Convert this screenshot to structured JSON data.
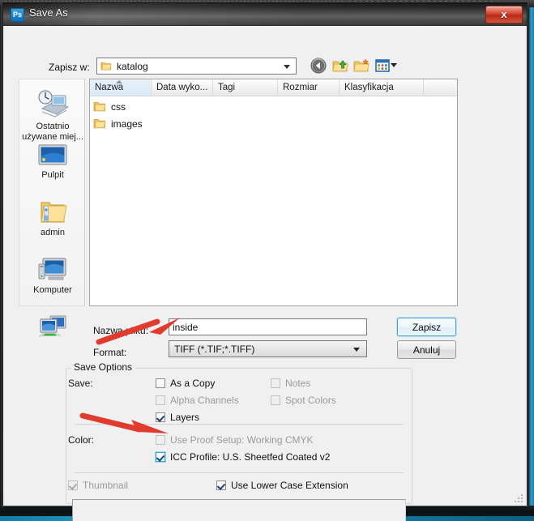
{
  "window": {
    "app_icon": "photoshop-icon",
    "app_icon_text": "Ps",
    "title": "Save As",
    "close_label": "x"
  },
  "toolbar": {
    "look_in_label": "Zapisz w:",
    "look_in_value": "katalog",
    "icons": [
      {
        "name": "back-icon",
        "title": "Wstecz"
      },
      {
        "name": "up-folder-icon",
        "title": "W górę"
      },
      {
        "name": "new-folder-icon",
        "title": "Nowy folder"
      },
      {
        "name": "views-icon",
        "title": "Widoki"
      }
    ]
  },
  "places": {
    "items": [
      {
        "icon": "recent-places-icon",
        "label": "Ostatnio",
        "label2": "używane miej..."
      },
      {
        "icon": "desktop-icon",
        "label": "Pulpit",
        "label2": ""
      },
      {
        "icon": "user-folder-icon",
        "label": "admin",
        "label2": ""
      },
      {
        "icon": "computer-icon",
        "label": "Komputer",
        "label2": ""
      },
      {
        "icon": "network-icon",
        "label": "",
        "label2": ""
      }
    ]
  },
  "file_list": {
    "columns": [
      "Nazwa",
      "Data wyko...",
      "Tagi",
      "Rozmiar",
      "Klasyfikacja"
    ],
    "sorted_column": "Nazwa",
    "sort_direction": "ascending",
    "rows": [
      {
        "icon": "folder-icon",
        "name": "css"
      },
      {
        "icon": "folder-icon",
        "name": "images"
      }
    ]
  },
  "fields": {
    "file_name_label": "Nazwa pliku:",
    "file_name_value": "inside",
    "format_label": "Format:",
    "format_value": "TIFF (*.TIF;*.TIFF)"
  },
  "buttons": {
    "save": "Zapisz",
    "cancel": "Anuluj"
  },
  "save_options": {
    "group_title": "Save Options",
    "save_label": "Save:",
    "color_label": "Color:",
    "checkboxes": {
      "as_a_copy": {
        "label": "As a Copy",
        "checked": false,
        "enabled": true
      },
      "notes": {
        "label": "Notes",
        "checked": false,
        "enabled": false
      },
      "alpha_channels": {
        "label": "Alpha Channels",
        "checked": false,
        "enabled": false
      },
      "spot_colors": {
        "label": "Spot Colors",
        "checked": false,
        "enabled": false
      },
      "layers": {
        "label": "Layers",
        "checked": true,
        "enabled": true
      },
      "use_proof_setup": {
        "label": "Use Proof Setup:  Working CMYK",
        "checked": false,
        "enabled": false
      },
      "icc_profile": {
        "label": "ICC Profile:  U.S. Sheetfed Coated v2",
        "checked": true,
        "enabled": true
      },
      "thumbnail": {
        "label": "Thumbnail",
        "checked": true,
        "enabled": false
      },
      "lower_case_extension": {
        "label": "Use Lower Case Extension",
        "checked": true,
        "enabled": true
      }
    }
  },
  "annotations": {
    "arrow_color": "#e03b2e",
    "arrow_1_target": "format-combo",
    "arrow_2_target": "icc-profile-checkbox"
  },
  "colors": {
    "dialog_background": "#f0f0f0",
    "title_bar": "#3a3a3a",
    "close_button": "#ba2b16",
    "accent": "#3c9fd6",
    "list_background": "#ffffff"
  }
}
